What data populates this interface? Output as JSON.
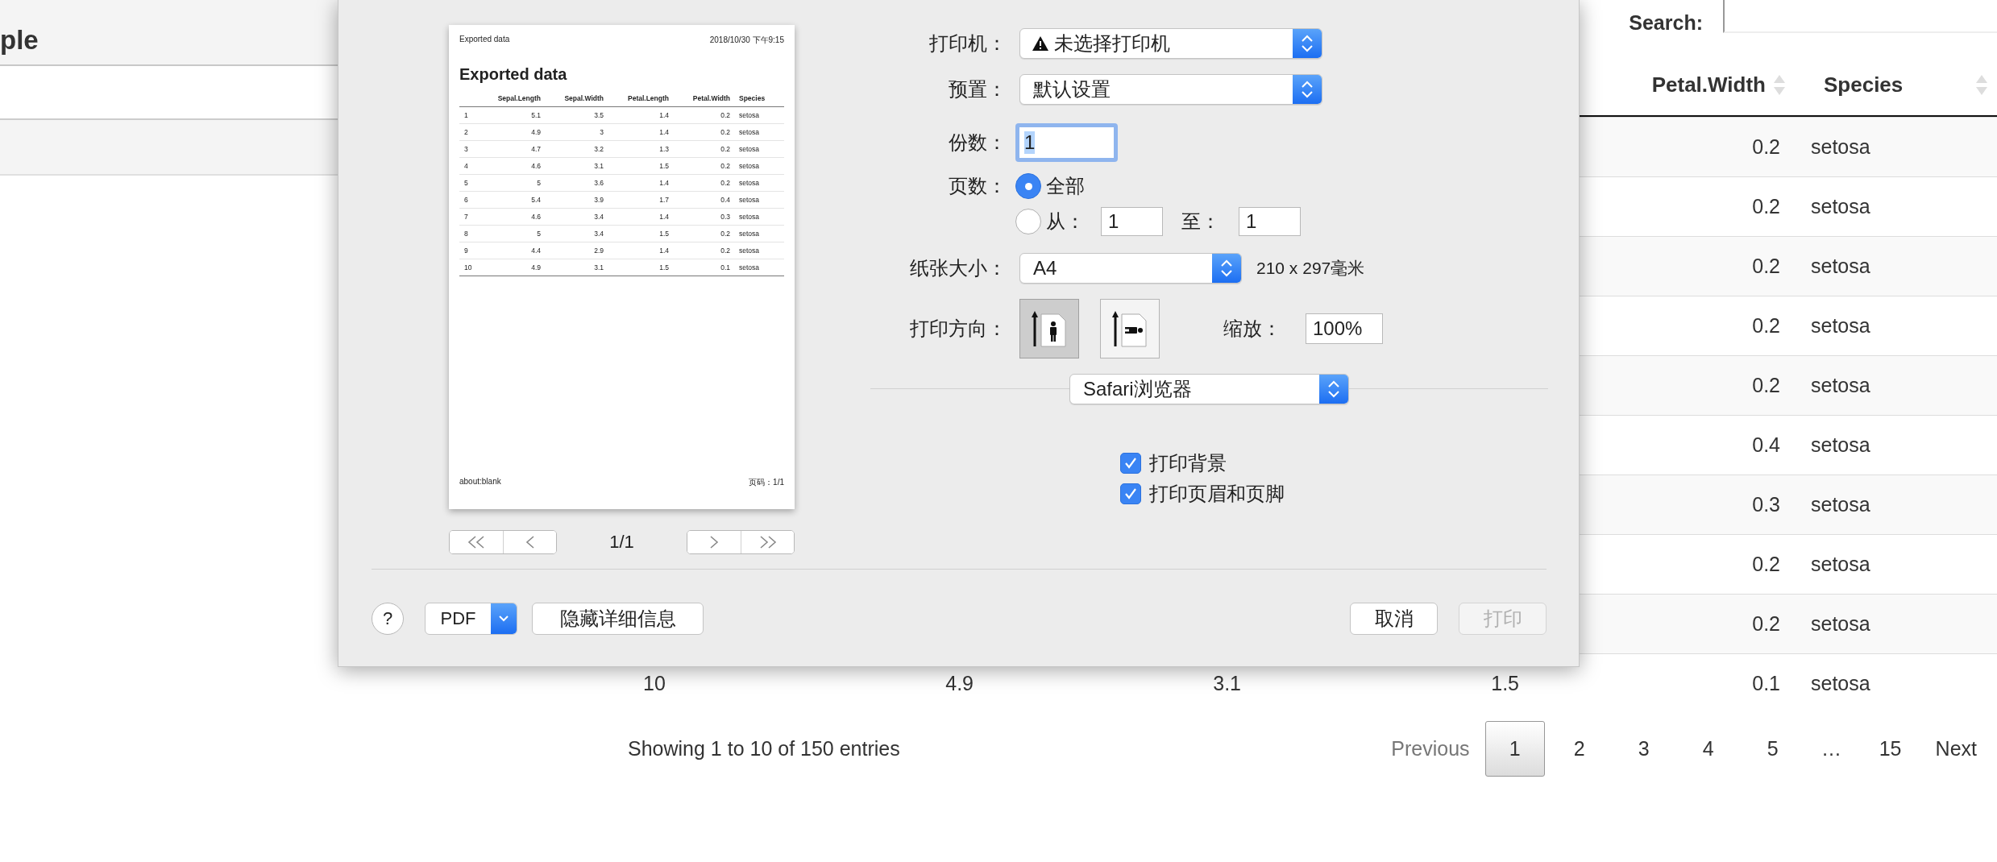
{
  "background": {
    "left_panel": {
      "title": "ple"
    },
    "search": {
      "label": "Search:"
    },
    "table": {
      "columns": [
        {
          "label": "Petal.Width"
        },
        {
          "label": "Species"
        }
      ],
      "rows": [
        {
          "cells": [
            "0.2",
            "setosa"
          ]
        },
        {
          "cells": [
            "0.2",
            "setosa"
          ]
        },
        {
          "cells": [
            "0.2",
            "setosa"
          ]
        },
        {
          "cells": [
            "0.2",
            "setosa"
          ]
        },
        {
          "cells": [
            "0.2",
            "setosa"
          ]
        },
        {
          "cells": [
            "0.4",
            "setosa"
          ]
        },
        {
          "cells": [
            "0.3",
            "setosa"
          ]
        },
        {
          "cells": [
            "0.2",
            "setosa"
          ]
        },
        {
          "cells": [
            "0.2",
            "setosa"
          ]
        },
        {
          "cells": [
            "10",
            "4.9",
            "3.1",
            "1.5",
            "0.1",
            "setosa"
          ]
        }
      ]
    },
    "info": "Showing 1 to 10 of 150 entries",
    "pagination": [
      {
        "kind": "nav",
        "label": "Previous",
        "selected": false,
        "disabled": true
      },
      {
        "kind": "page",
        "label": "1",
        "selected": true,
        "disabled": false
      },
      {
        "kind": "page",
        "label": "2",
        "selected": false,
        "disabled": false
      },
      {
        "kind": "page",
        "label": "3",
        "selected": false,
        "disabled": false
      },
      {
        "kind": "page",
        "label": "4",
        "selected": false,
        "disabled": false
      },
      {
        "kind": "page",
        "label": "5",
        "selected": false,
        "disabled": false
      },
      {
        "kind": "ellipsis",
        "label": "…",
        "selected": false,
        "disabled": false
      },
      {
        "kind": "page",
        "label": "15",
        "selected": false,
        "disabled": false
      },
      {
        "kind": "nav",
        "label": "Next",
        "selected": false,
        "disabled": false
      }
    ]
  },
  "print_dialog": {
    "preview": {
      "header_left": "Exported data",
      "header_right": "2018/10/30 下午9:15",
      "title": "Exported data",
      "columns": [
        "",
        "Sepal.Length",
        "Sepal.Width",
        "Petal.Length",
        "Petal.Width",
        "Species"
      ],
      "rows": [
        [
          "1",
          "5.1",
          "3.5",
          "1.4",
          "0.2",
          "setosa"
        ],
        [
          "2",
          "4.9",
          "3",
          "1.4",
          "0.2",
          "setosa"
        ],
        [
          "3",
          "4.7",
          "3.2",
          "1.3",
          "0.2",
          "setosa"
        ],
        [
          "4",
          "4.6",
          "3.1",
          "1.5",
          "0.2",
          "setosa"
        ],
        [
          "5",
          "5",
          "3.6",
          "1.4",
          "0.2",
          "setosa"
        ],
        [
          "6",
          "5.4",
          "3.9",
          "1.7",
          "0.4",
          "setosa"
        ],
        [
          "7",
          "4.6",
          "3.4",
          "1.4",
          "0.3",
          "setosa"
        ],
        [
          "8",
          "5",
          "3.4",
          "1.5",
          "0.2",
          "setosa"
        ],
        [
          "9",
          "4.4",
          "2.9",
          "1.4",
          "0.2",
          "setosa"
        ],
        [
          "10",
          "4.9",
          "3.1",
          "1.5",
          "0.1",
          "setosa"
        ]
      ],
      "footer_left": "about:blank",
      "footer_right": "页码：1/1"
    },
    "page_indicator": "1/1",
    "printer": {
      "label": "打印机：",
      "value": "未选择打印机"
    },
    "preset": {
      "label": "预置：",
      "value": "默认设置"
    },
    "copies": {
      "label": "份数：",
      "value": "1"
    },
    "pages": {
      "label": "页数：",
      "options": [
        {
          "kind": "all",
          "label": "全部",
          "selected": true
        },
        {
          "kind": "range",
          "label": "从：",
          "selected": false,
          "from": "1",
          "to_label": "至：",
          "to": "1"
        }
      ]
    },
    "paper_size": {
      "label": "纸张大小：",
      "value": "A4",
      "dimensions": "210 x 297毫米"
    },
    "orientation": {
      "label": "打印方向：",
      "options": [
        {
          "kind": "portrait",
          "selected": true
        },
        {
          "kind": "landscape",
          "selected": false
        }
      ]
    },
    "scale": {
      "label": "缩放：",
      "value": "100%"
    },
    "section_popup": {
      "value": "Safari浏览器"
    },
    "options": [
      {
        "label": "打印背景",
        "checked": true
      },
      {
        "label": "打印页眉和页脚",
        "checked": true
      }
    ],
    "help": "?",
    "pdf_menu": "PDF",
    "details_button": "隐藏详细信息",
    "buttons": [
      {
        "label": "取消",
        "disabled": false
      },
      {
        "label": "打印",
        "disabled": true
      }
    ]
  }
}
